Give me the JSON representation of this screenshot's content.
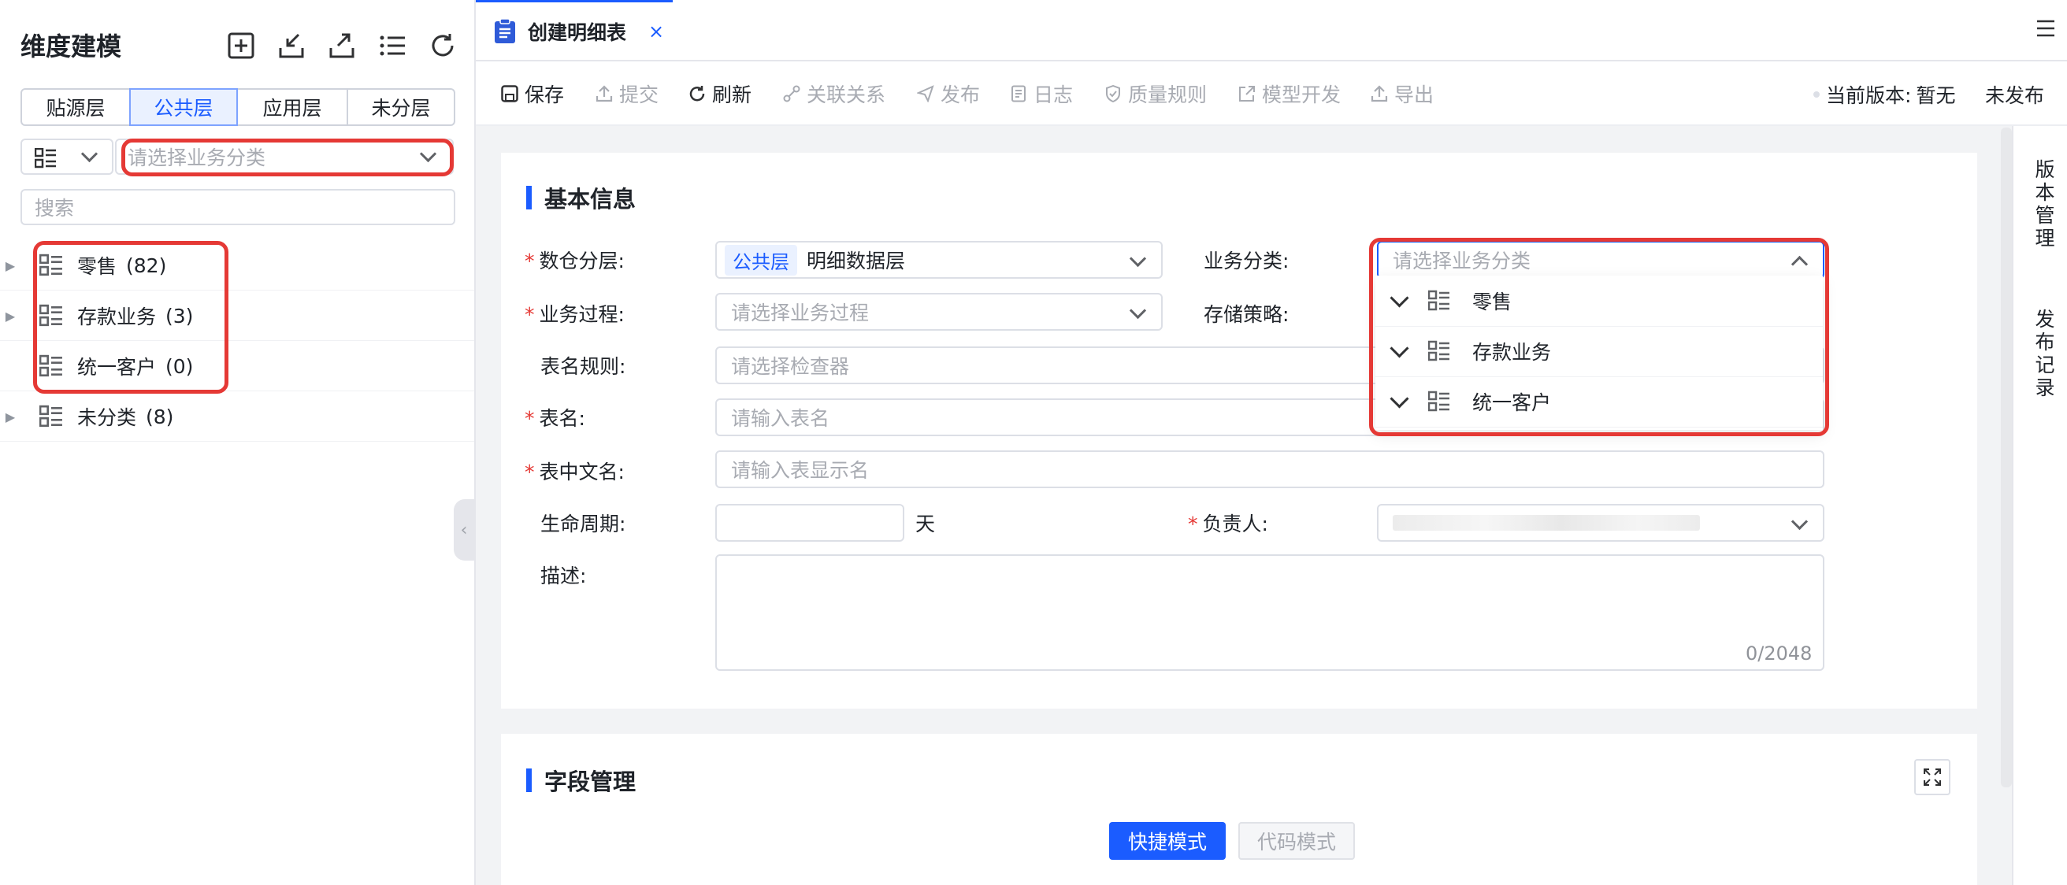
{
  "sidebar": {
    "title": "维度建模",
    "toolbar_icons": [
      "add-square-icon",
      "import-icon",
      "export-icon",
      "list-icon",
      "refresh-icon"
    ],
    "layer_tabs": [
      {
        "label": "贴源层",
        "active": false
      },
      {
        "label": "公共层",
        "active": true
      },
      {
        "label": "应用层",
        "active": false
      },
      {
        "label": "未分层",
        "active": false
      }
    ],
    "category_placeholder": "请选择业务分类",
    "search_placeholder": "搜索",
    "tree": [
      {
        "label": "零售",
        "count": "(82)",
        "expandable": true
      },
      {
        "label": "存款业务",
        "count": "(3)",
        "expandable": true
      },
      {
        "label": "统一客户",
        "count": "(0)",
        "expandable": false
      },
      {
        "label": "未分类",
        "count": "(8)",
        "expandable": true
      }
    ]
  },
  "tab": {
    "title": "创建明细表",
    "close": "×"
  },
  "toolbar": {
    "save": "保存",
    "submit": "提交",
    "refresh": "刷新",
    "relation": "关联关系",
    "publish": "发布",
    "log": "日志",
    "quality": "质量规则",
    "model_dev": "模型开发",
    "export": "导出",
    "version_label": "当前版本:",
    "version_value": "暂无",
    "status": "未发布"
  },
  "basic": {
    "title": "基本信息",
    "layer_label": "数仓分层:",
    "layer_tag": "公共层",
    "layer_value": "明细数据层",
    "process_label": "业务过程:",
    "process_placeholder": "请选择业务过程",
    "naming_label": "表名规则:",
    "naming_placeholder": "请选择检查器",
    "name_label": "表名:",
    "name_placeholder": "请输入表名",
    "cn_name_label": "表中文名:",
    "cn_name_placeholder": "请输入表显示名",
    "lifecycle_label": "生命周期:",
    "lifecycle_unit": "天",
    "desc_label": "描述:",
    "desc_count": "0/2048",
    "category_label": "业务分类:",
    "category_placeholder": "请选择业务分类",
    "storage_label": "存储策略:",
    "owner_label": "负责人:"
  },
  "dropdown": {
    "items": [
      {
        "label": "零售"
      },
      {
        "label": "存款业务"
      },
      {
        "label": "统一客户"
      }
    ]
  },
  "fields": {
    "title": "字段管理",
    "quick_mode": "快捷模式",
    "code_mode": "代码模式"
  },
  "right_strip": {
    "version_mgmt": "版本管理",
    "publish_record": "发布记录"
  },
  "colors": {
    "accent": "#1b5cff",
    "highlight": "#e53935",
    "required": "#e53935"
  }
}
